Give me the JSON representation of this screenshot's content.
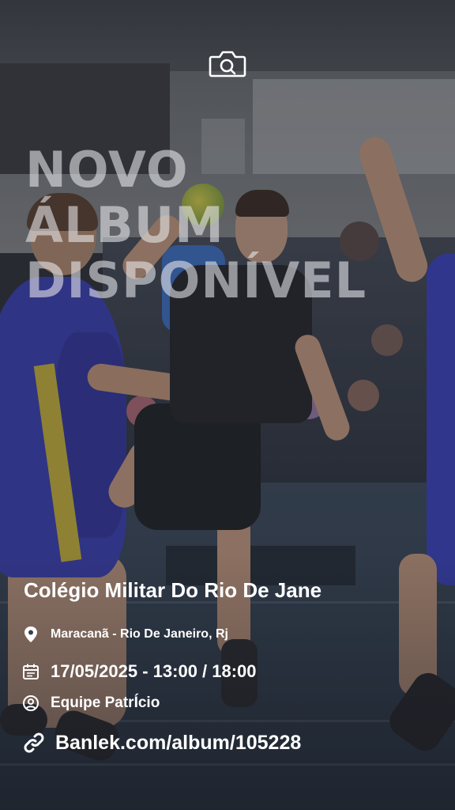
{
  "header": {
    "camera_icon": "camera-icon"
  },
  "headline": {
    "lines": [
      "NOVO",
      "ÁLBUM",
      "DISPONÍVEL"
    ]
  },
  "event": {
    "title": "Colégio Militar Do Rio De Jane",
    "location": "Maracanã - Rio De Janeiro, Rj",
    "datetime": "17/05/2025 - 13:00 / 18:00",
    "team": "Equipe PatrÍcio",
    "link": "Banlek.com/album/105228"
  },
  "icons": {
    "location": "map-pin-icon",
    "date": "calendar-icon",
    "team": "user-circle-icon",
    "link": "link-icon"
  },
  "colors": {
    "text": "#ffffff",
    "headline": "#ebebee"
  }
}
